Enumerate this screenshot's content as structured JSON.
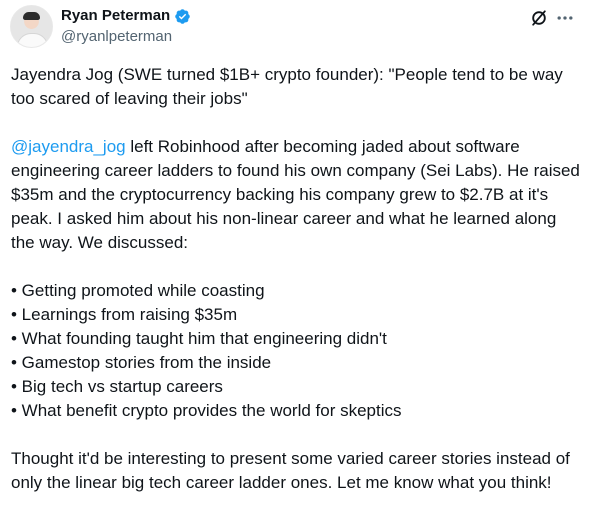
{
  "author": {
    "display_name": "Ryan Peterman",
    "handle": "@ryanlpeterman",
    "verified": true,
    "avatar": "avatar-photo"
  },
  "header_icons": [
    "grok-icon",
    "more-icon"
  ],
  "tweet": {
    "headline": "Jayendra Jog (SWE turned $1B+ crypto founder): \"People tend to be way too scared of leaving their jobs\"",
    "mention": "@jayendra_jog",
    "intro_rest": " left Robinhood after becoming jaded about software engineering career ladders to found his own company (Sei Labs). He raised $35m and the cryptocurrency backing his company grew to $2.7B at it's peak. I asked him about his non-linear career and what he learned along the way. We discussed:",
    "bullets": [
      "• Getting promoted while coasting",
      "• Learnings from raising $35m",
      "• What founding taught him that engineering didn't",
      "• Gamestop stories from the inside",
      "• Big tech vs startup careers",
      "• What benefit crypto provides the world for skeptics"
    ],
    "closing": "Thought it'd be interesting to present some varied career stories instead of only the linear big tech career ladder ones. Let me know what you think!"
  },
  "colors": {
    "text": "#0f1419",
    "secondary": "#536471",
    "link": "#1d9bf0",
    "verified_badge": "#1d9bf0"
  }
}
